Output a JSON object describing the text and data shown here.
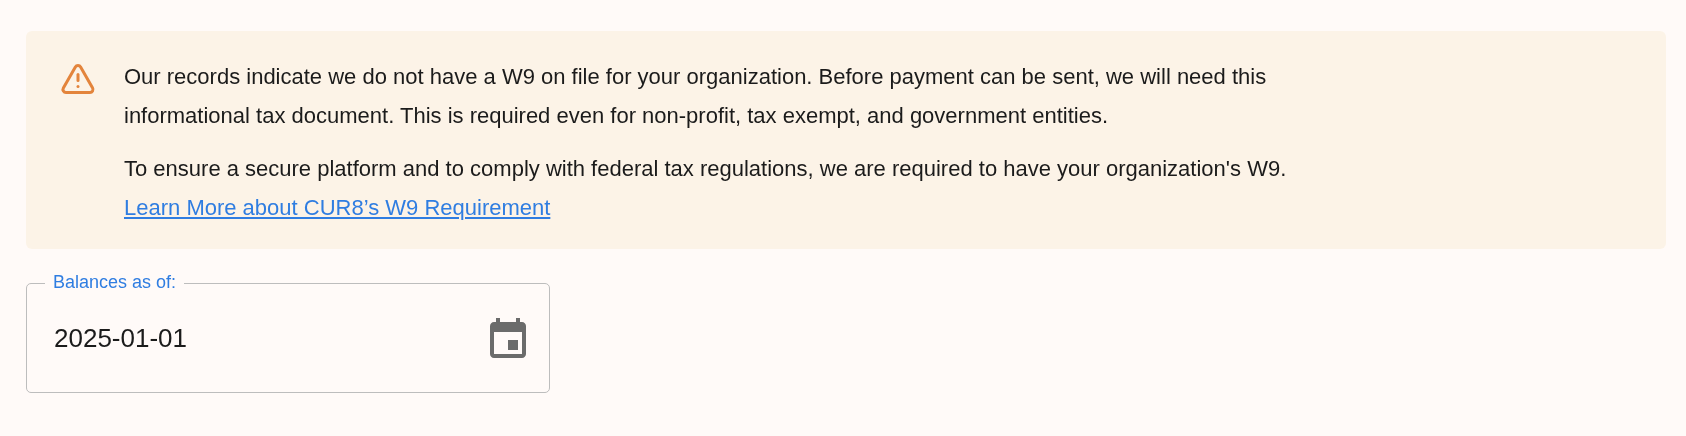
{
  "alert": {
    "kind": "warning",
    "paragraphs": [
      "Our records indicate we do not have a W9 on file for your organization. Before payment can be sent, we will need this informational tax document. This is required even for non-profit, tax exempt, and government entities.",
      "To ensure a secure platform and to comply with federal tax regulations, we are required to have your organization's W9."
    ],
    "link": "Learn More about CUR8’s W9 Requirement"
  },
  "date_field": {
    "label": "Balances as of:",
    "value": "2025-01-01"
  }
}
